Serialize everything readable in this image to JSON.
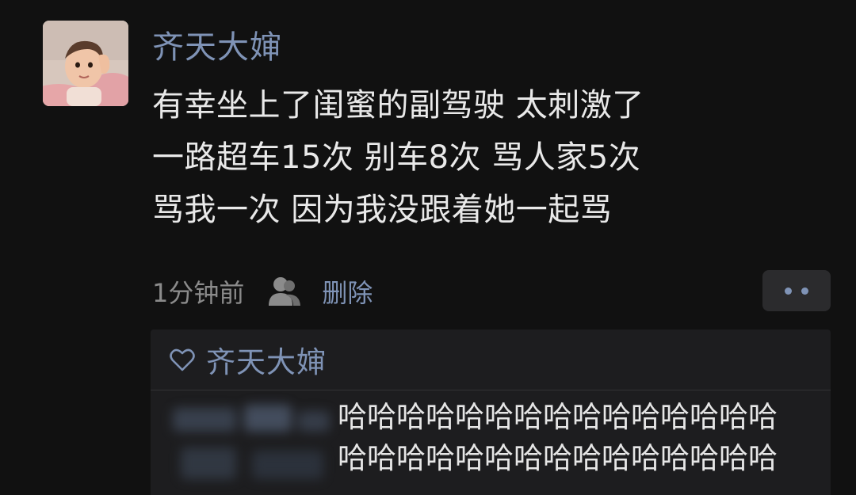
{
  "post": {
    "author": "齐天大婶",
    "lines": [
      "有幸坐上了闺蜜的副驾驶 太刺激了",
      "一路超车15次 别车8次 骂人家5次",
      "骂我一次 因为我没跟着她一起骂"
    ],
    "time": "1分钟前",
    "delete_label": "删除",
    "icons": {
      "visibility": "person-icon",
      "more": "more-dots-icon",
      "like": "heart-icon"
    }
  },
  "likes": {
    "users": [
      "齐天大婶"
    ]
  },
  "comment": {
    "lines": [
      "哈哈哈哈哈哈哈哈哈哈哈哈哈哈哈",
      "哈哈哈哈哈哈哈哈哈哈哈哈哈哈哈"
    ]
  },
  "colors": {
    "background": "#111111",
    "link": "#7f93b6",
    "text": "#e9e9e9",
    "muted": "#8b8b8b",
    "panel": "#1d1d1f"
  }
}
